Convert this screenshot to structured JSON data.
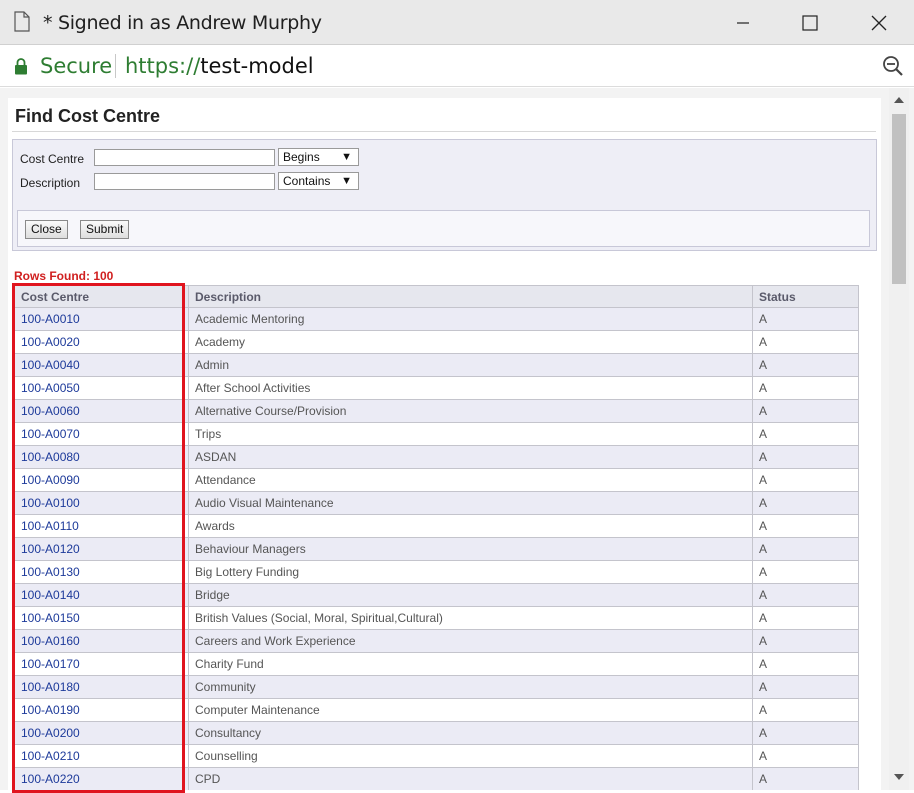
{
  "window": {
    "title": "* Signed in as Andrew Murphy"
  },
  "address_bar": {
    "secure_label": "Secure",
    "url_scheme": "https://",
    "url_host": "test-model"
  },
  "page": {
    "title": "Find Cost Centre"
  },
  "search": {
    "cost_centre_label": "Cost Centre",
    "cost_centre_value": "",
    "cost_centre_match": "Begins",
    "description_label": "Description",
    "description_value": "",
    "description_match": "Contains",
    "close_label": "Close",
    "submit_label": "Submit"
  },
  "results": {
    "rows_found": "Rows Found: 100",
    "headers": [
      "Cost Centre",
      "Description",
      "Status"
    ],
    "rows": [
      [
        "100-A0010",
        "Academic Mentoring",
        "A"
      ],
      [
        "100-A0020",
        "Academy",
        "A"
      ],
      [
        "100-A0040",
        "Admin",
        "A"
      ],
      [
        "100-A0050",
        "After School Activities",
        "A"
      ],
      [
        "100-A0060",
        "Alternative Course/Provision",
        "A"
      ],
      [
        "100-A0070",
        "Trips",
        "A"
      ],
      [
        "100-A0080",
        "ASDAN",
        "A"
      ],
      [
        "100-A0090",
        "Attendance",
        "A"
      ],
      [
        "100-A0100",
        "Audio Visual Maintenance",
        "A"
      ],
      [
        "100-A0110",
        "Awards",
        "A"
      ],
      [
        "100-A0120",
        "Behaviour Managers",
        "A"
      ],
      [
        "100-A0130",
        "Big Lottery Funding",
        "A"
      ],
      [
        "100-A0140",
        "Bridge",
        "A"
      ],
      [
        "100-A0150",
        "British Values (Social, Moral, Spiritual,Cultural)",
        "A"
      ],
      [
        "100-A0160",
        "Careers and Work Experience",
        "A"
      ],
      [
        "100-A0170",
        "Charity Fund",
        "A"
      ],
      [
        "100-A0180",
        "Community",
        "A"
      ],
      [
        "100-A0190",
        "Computer Maintenance",
        "A"
      ],
      [
        "100-A0200",
        "Consultancy",
        "A"
      ],
      [
        "100-A0210",
        "Counselling",
        "A"
      ],
      [
        "100-A0220",
        "CPD",
        "A"
      ]
    ]
  },
  "colors": {
    "highlight": "#e0141e",
    "rows_found": "#d01f1f",
    "link": "#1d3a9a",
    "secure": "#2e7d32"
  }
}
